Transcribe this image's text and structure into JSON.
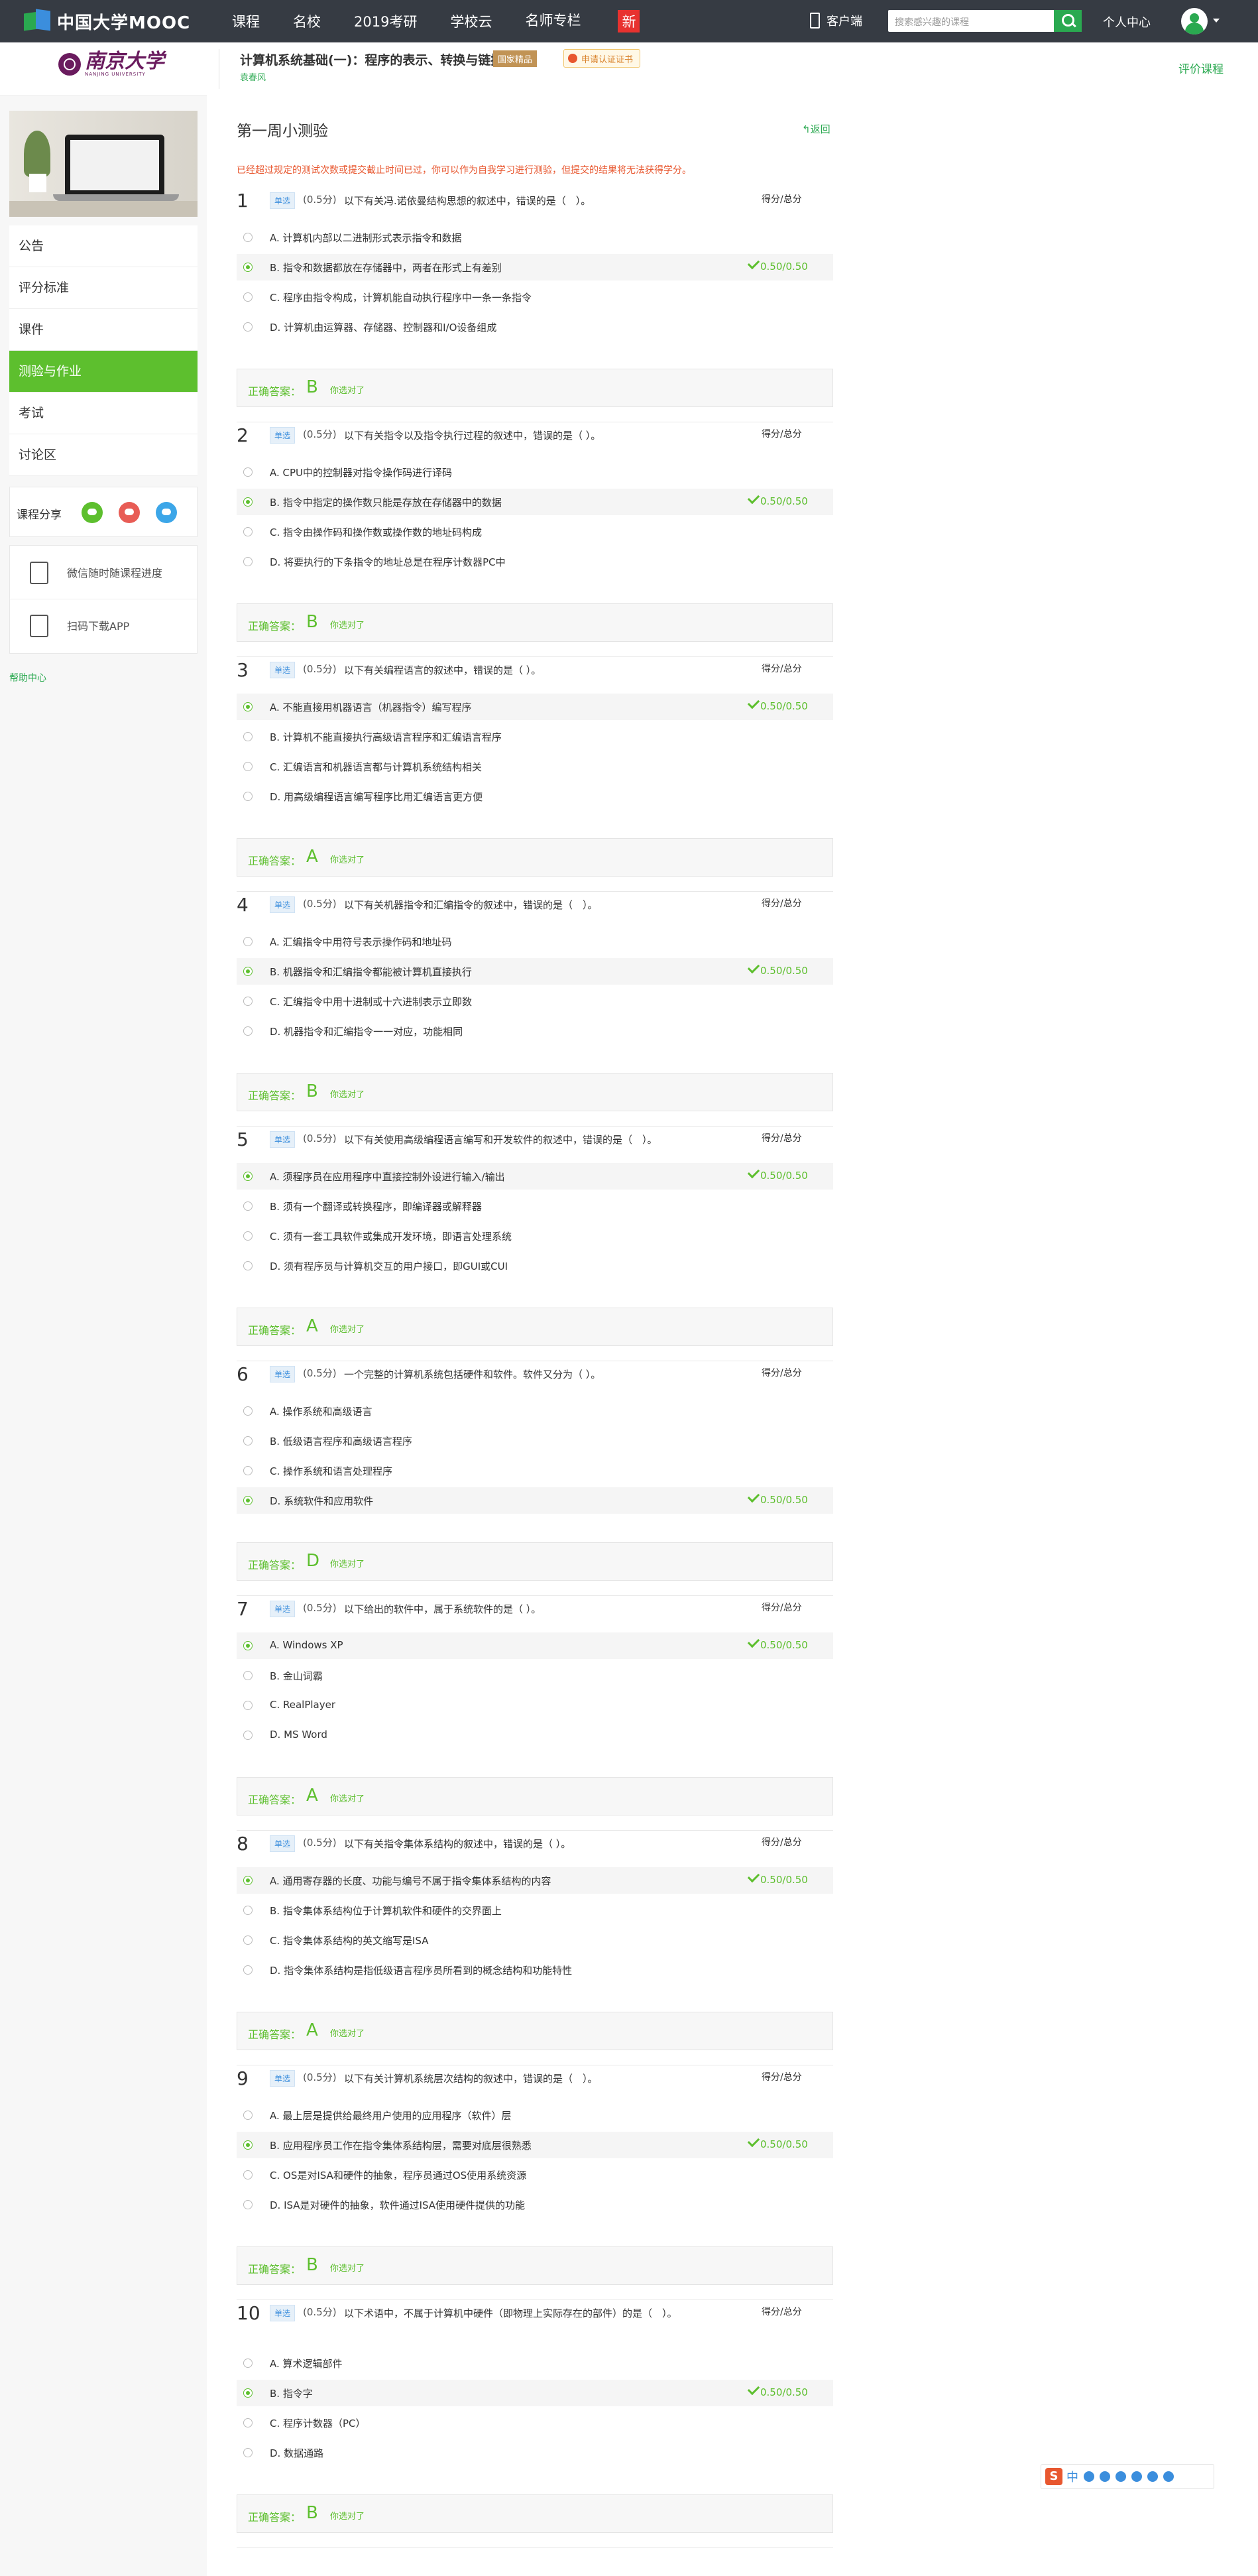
{
  "topnav": {
    "logo": "中国大学MOOC",
    "links": [
      "课程",
      "名校",
      "2019考研",
      "学校云",
      "名师专栏"
    ],
    "hot_badge": "新",
    "client": "客户端",
    "search_placeholder": "搜索感兴趣的课程",
    "user_center": "个人中心"
  },
  "course": {
    "university_cn": "南京大学",
    "university_en": "NANJING UNIVERSITY",
    "title": "计算机系统基础(一)：程序的表示、转换与链接",
    "badge": "国家精品",
    "cert": "申请认证证书",
    "teacher": "袁春风",
    "rate": "评价课程"
  },
  "sidebar": {
    "menu": [
      "公告",
      "评分标准",
      "课件",
      "测验与作业",
      "考试",
      "讨论区"
    ],
    "active_index": 3,
    "share_label": "课程分享",
    "tools": [
      "微信随时随课程进度",
      "扫码下载APP"
    ],
    "help": "帮助中心"
  },
  "quiz": {
    "title": "第一周小测验",
    "back": "返回",
    "notice": "已经超过规定的测试次数或提交截止时间已过，你可以作为自我学习进行测验，但提交的结果将无法获得学分。",
    "score_header": "得分/总分",
    "type_label": "单选",
    "answer_label": "正确答案：",
    "correct_text": "你选对了",
    "questions": [
      {
        "num": "1",
        "score": "(0.5分)",
        "stem": "以下有关冯.诺依曼结构思想的叙述中，错误的是（　）。",
        "options": [
          "A. 计算机内部以二进制形式表示指令和数据",
          "B. 指令和数据都放在存储器中，两者在形式上有差别",
          "C. 程序由指令构成，计算机能自动执行程序中一条一条指令",
          "D. 计算机由运算器、存储器、控制器和I/O设备组成"
        ],
        "selected": 1,
        "points": "0.50/0.50",
        "answer": "B"
      },
      {
        "num": "2",
        "score": "(0.5分)",
        "stem": "以下有关指令以及指令执行过程的叙述中，错误的是（ ）。",
        "options": [
          "A. CPU中的控制器对指令操作码进行译码",
          "B. 指令中指定的操作数只能是存放在存储器中的数据",
          "C. 指令由操作码和操作数或操作数的地址码构成",
          "D. 将要执行的下条指令的地址总是在程序计数器PC中"
        ],
        "selected": 1,
        "points": "0.50/0.50",
        "answer": "B"
      },
      {
        "num": "3",
        "score": "(0.5分)",
        "stem": "以下有关编程语言的叙述中，错误的是（ ）。",
        "options": [
          "A. 不能直接用机器语言（机器指令）编写程序",
          "B. 计算机不能直接执行高级语言程序和汇编语言程序",
          "C. 汇编语言和机器语言都与计算机系统结构相关",
          "D. 用高级编程语言编写程序比用汇编语言更方便"
        ],
        "selected": 0,
        "points": "0.50/0.50",
        "answer": "A"
      },
      {
        "num": "4",
        "score": "(0.5分)",
        "stem": "以下有关机器指令和汇编指令的叙述中，错误的是（　）。",
        "options": [
          "A. 汇编指令中用符号表示操作码和地址码",
          "B. 机器指令和汇编指令都能被计算机直接执行",
          "C. 汇编指令中用十进制或十六进制表示立即数",
          "D. 机器指令和汇编指令一一对应，功能相同"
        ],
        "selected": 1,
        "points": "0.50/0.50",
        "answer": "B"
      },
      {
        "num": "5",
        "score": "(0.5分)",
        "stem": "以下有关使用高级编程语言编写和开发软件的叙述中，错误的是（　）。",
        "options": [
          "A. 须程序员在应用程序中直接控制外设进行输入/输出",
          "B. 须有一个翻译或转换程序，即编译器或解释器",
          "C. 须有一套工具软件或集成开发环境，即语言处理系统",
          "D. 须有程序员与计算机交互的用户接口，即GUI或CUI"
        ],
        "selected": 0,
        "points": "0.50/0.50",
        "answer": "A"
      },
      {
        "num": "6",
        "score": "(0.5分)",
        "stem": "一个完整的计算机系统包括硬件和软件。软件又分为（ ）。",
        "options": [
          "A. 操作系统和高级语言",
          "B. 低级语言程序和高级语言程序",
          "C. 操作系统和语言处理程序",
          "D. 系统软件和应用软件"
        ],
        "selected": 3,
        "points": "0.50/0.50",
        "answer": "D"
      },
      {
        "num": "7",
        "score": "(0.5分)",
        "stem": "以下给出的软件中，属于系统软件的是（ ）。",
        "options": [
          "A. Windows XP",
          "B. 金山词霸",
          "C. RealPlayer",
          "D. MS Word"
        ],
        "selected": 0,
        "points": "0.50/0.50",
        "answer": "A"
      },
      {
        "num": "8",
        "score": "(0.5分)",
        "stem": "以下有关指令集体系结构的叙述中，错误的是（ ）。",
        "options": [
          "A. 通用寄存器的长度、功能与编号不属于指令集体系结构的内容",
          "B. 指令集体系结构位于计算机软件和硬件的交界面上",
          "C. 指令集体系结构的英文缩写是ISA",
          "D. 指令集体系结构是指低级语言程序员所看到的概念结构和功能特性"
        ],
        "selected": 0,
        "points": "0.50/0.50",
        "answer": "A"
      },
      {
        "num": "9",
        "score": "(0.5分)",
        "stem": "以下有关计算机系统层次结构的叙述中，错误的是（　）。",
        "options": [
          "A. 最上层是提供给最终用户使用的应用程序（软件）层",
          "B. 应用程序员工作在指令集体系结构层，需要对底层很熟悉",
          "C. OS是对ISA和硬件的抽象，程序员通过OS使用系统资源",
          "D. ISA是对硬件的抽象，软件通过ISA使用硬件提供的功能"
        ],
        "selected": 1,
        "points": "0.50/0.50",
        "answer": "B"
      },
      {
        "num": "10",
        "score": "(0.5分)",
        "stem": "以下术语中，不属于计算机中硬件（即物理上实际存在的部件）的是（　）。",
        "options": [
          "A. 算术逻辑部件",
          "B. 指令字",
          "C. 程序计数器（PC）",
          "D. 数据通路"
        ],
        "selected": 1,
        "points": "0.50/0.50",
        "answer": "B"
      }
    ]
  },
  "ime": {
    "logo": "S",
    "lang": "中"
  }
}
